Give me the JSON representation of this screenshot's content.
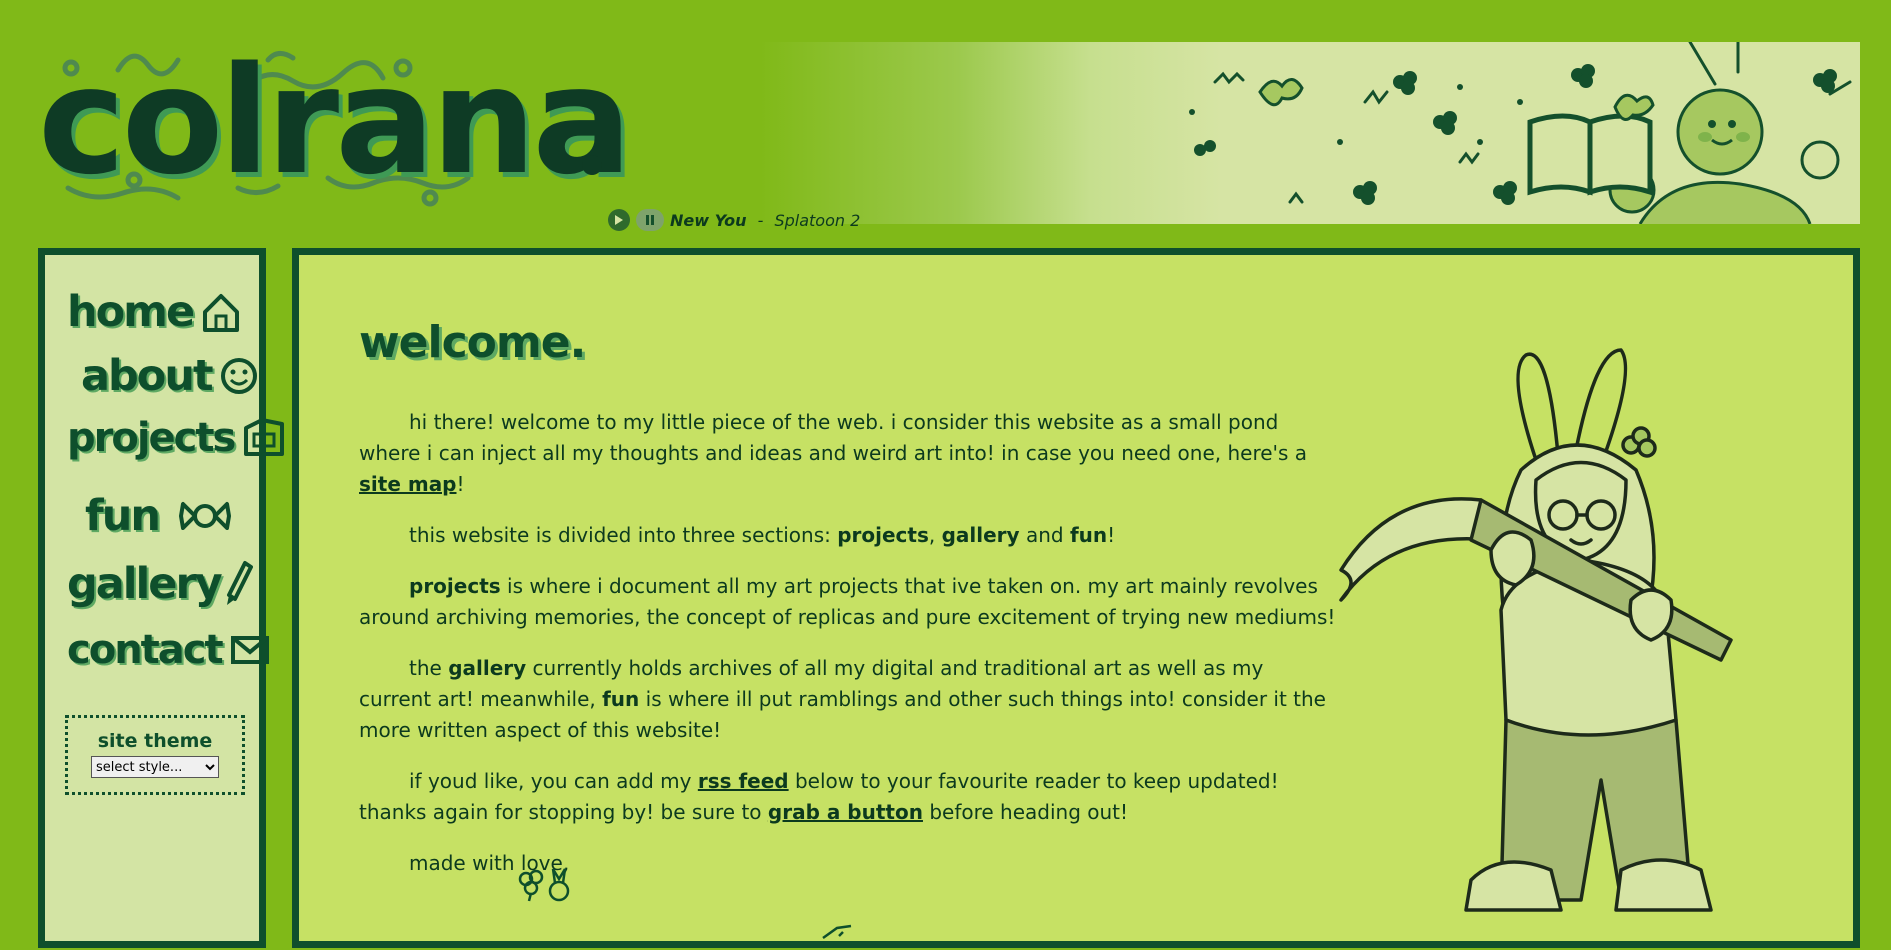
{
  "header": {
    "logo_text": "colrana",
    "music": {
      "track": "New You",
      "separator": " - ",
      "artist": "Splatoon 2"
    }
  },
  "sidebar": {
    "nav": [
      {
        "label": "home",
        "icon": "house-icon"
      },
      {
        "label": "about",
        "icon": "smiley-icon"
      },
      {
        "label": "projects",
        "icon": "folder-icon"
      },
      {
        "label": "fun",
        "icon": "candy-icon"
      },
      {
        "label": "gallery",
        "icon": "paintbrush-icon"
      },
      {
        "label": "contact",
        "icon": "envelope-icon"
      }
    ],
    "theme": {
      "label": "site theme",
      "selected": "select style..."
    }
  },
  "main": {
    "title": "welcome.",
    "p1": {
      "text_a": "hi there! welcome to my little piece of the web. i consider this website as a small pond where i can inject all my thoughts and ideas and weird art into! in case you need one, here's a ",
      "link": "site map",
      "text_b": "!"
    },
    "p2": {
      "text_a": "this website is divided into three sections: ",
      "b1": "projects",
      "sep1": ", ",
      "b2": "gallery",
      "sep2": " and ",
      "b3": "fun",
      "text_b": "!"
    },
    "p3": {
      "b1": "projects",
      "text_a": " is where i document all my art projects that ive taken on. my art mainly revolves around archiving memories, the concept of replicas and pure excitement of trying new mediums!"
    },
    "p4": {
      "text_a": "the ",
      "b1": "gallery",
      "text_b": " currently holds archives of all my digital and traditional art as well as my current art! meanwhile, ",
      "b2": "fun",
      "text_c": " is where ill put ramblings and other such things into! consider it the more written aspect of this website!"
    },
    "p5": {
      "text_a": "if youd like, you can add my ",
      "link1": "rss feed",
      "text_b": " below to your favourite reader to keep updated! thanks again for stopping by! be sure to ",
      "link2": "grab a button",
      "text_c": " before heading out!"
    },
    "p6": "made with love,"
  },
  "colors": {
    "page_bg": "#80b918",
    "panel_bg": "#c6e164",
    "sidebar_bg": "#d3e4a4",
    "border": "#0e4f2c",
    "text": "#0c3a1e"
  }
}
